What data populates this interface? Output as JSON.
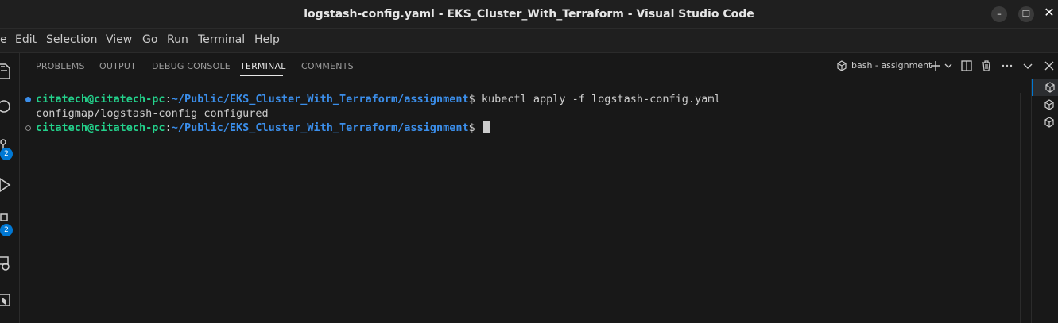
{
  "window": {
    "title": "logstash-config.yaml - EKS_Cluster_With_Terraform - Visual Studio Code",
    "minimize_glyph": "–",
    "maximize_glyph": "❐",
    "close_glyph": "✕"
  },
  "menu": [
    "e",
    "Edit",
    "Selection",
    "View",
    "Go",
    "Run",
    "Terminal",
    "Help"
  ],
  "activity_bar": {
    "source_control_badge": "2",
    "extensions_badge": "2"
  },
  "panel": {
    "tabs": [
      "PROBLEMS",
      "OUTPUT",
      "DEBUG CONSOLE",
      "TERMINAL",
      "COMMENTS"
    ],
    "active_tab": "TERMINAL",
    "terminal_name": "bash - assignment"
  },
  "terminal": {
    "lines": [
      {
        "user": "citatech@citatech-pc",
        "sep": ":",
        "path": "~/Public/EKS_Cluster_With_Terraform/assignment",
        "symbol": "$",
        "command": " kubectl apply -f logstash-config.yaml"
      },
      {
        "output": "configmap/logstash-config configured"
      },
      {
        "user": "citatech@citatech-pc",
        "sep": ":",
        "path": "~/Public/EKS_Cluster_With_Terraform/assignment",
        "symbol": "$",
        "command": " "
      }
    ]
  },
  "colors": {
    "accent": "#0078d4",
    "prompt_user": "#23d18b",
    "prompt_path": "#3b8eea",
    "success_dot": "#3b8eea"
  }
}
